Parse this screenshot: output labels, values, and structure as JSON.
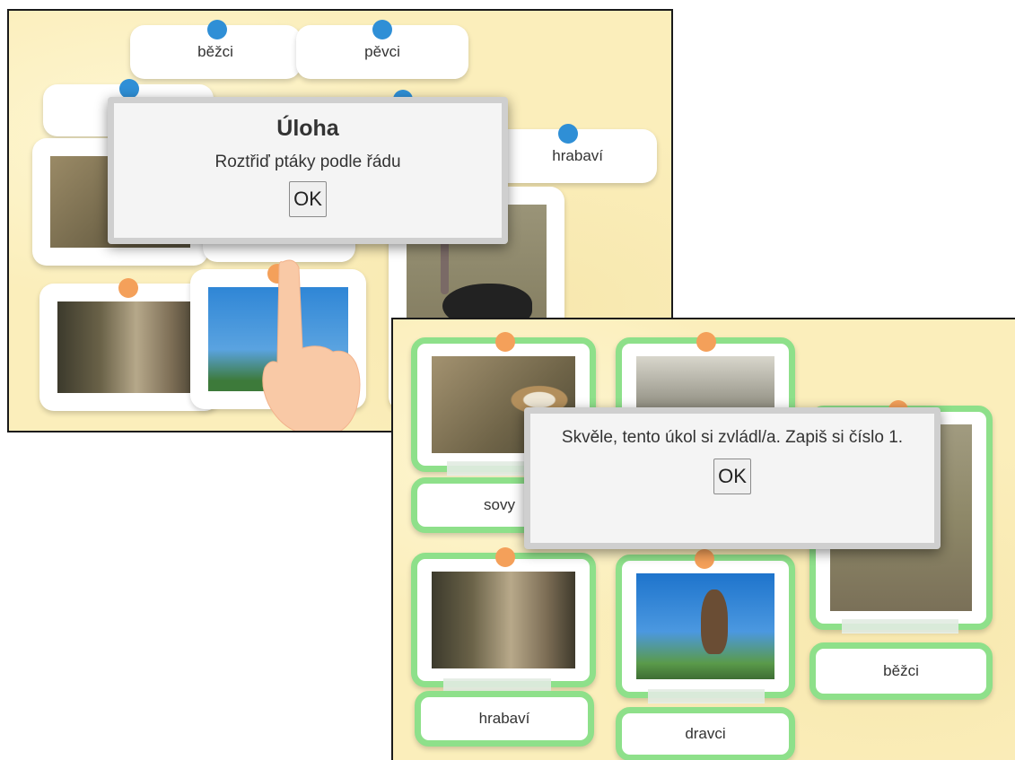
{
  "panel_1": {
    "labels": [
      "běžci",
      "pěvci",
      "hrabaví"
    ],
    "dialog": {
      "title": "Úloha",
      "message": "Roztřiď ptáky podle řádu",
      "ok_label": "OK"
    }
  },
  "panel_2": {
    "labels": [
      "sovy",
      "běžci",
      "hrabaví",
      "dravci"
    ],
    "dialog": {
      "message": "Skvěle, tento úkol si zvládl/a. Zapiš si číslo 1.",
      "ok_label": "OK"
    }
  },
  "colors": {
    "accent_green": "#8ee08a",
    "dot_blue": "#2f8fd6",
    "dot_orange": "#f4a05a",
    "background": "#fbeebb"
  },
  "icons": [
    "hand-pointer-icon"
  ]
}
